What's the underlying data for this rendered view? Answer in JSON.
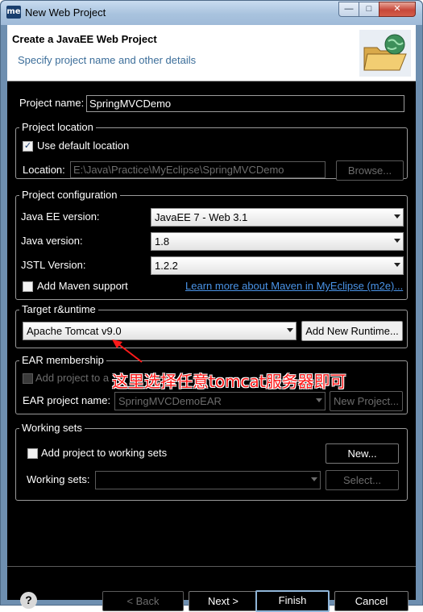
{
  "window": {
    "title": "New Web Project",
    "app_icon": "me",
    "minimize_glyph": "—",
    "maximize_glyph": "□",
    "close_glyph": "✕"
  },
  "header": {
    "title": "Create a JavaEE Web Project",
    "subtitle": "Specify project name and other details",
    "graphic_icon": "folder-globe-icon"
  },
  "project_name": {
    "label": "Project name:",
    "value": "SpringMVCDemo"
  },
  "project_location": {
    "legend": "Project location",
    "use_default_label": "Use default location",
    "use_default_checked": true,
    "location_label": "Location:",
    "location_value": "E:\\Java\\Practice\\MyEclipse\\SpringMVCDemo",
    "browse_label": "Browse..."
  },
  "project_configuration": {
    "legend": "Project configuration",
    "javaee_label": "Java EE version:",
    "javaee_value": "JavaEE 7 - Web 3.1",
    "java_label": "Java version:",
    "java_value": "1.8",
    "jstl_label": "JSTL Version:",
    "jstl_value": "1.2.2",
    "maven_label": "Add Maven support",
    "maven_checked": false,
    "maven_link": "Learn more about Maven in MyEclipse (m2e)..."
  },
  "target_runtime": {
    "legend": "Target r&untime",
    "runtime_value": "Apache Tomcat v9.0",
    "add_runtime_label": "Add New Runtime..."
  },
  "ear_membership": {
    "legend": "EAR membership",
    "add_to_ear_label": "Add project to a",
    "ear_name_label": "EAR project name:",
    "ear_name_value": "SpringMVCDemoEAR",
    "new_project_label": "New Project..."
  },
  "working_sets": {
    "legend": "Working sets",
    "add_label": "Add project to working sets",
    "new_label": "New...",
    "sets_label": "Working sets:",
    "sets_value": "",
    "select_label": "Select..."
  },
  "annotation": {
    "text": "这里选择任意tomcat服务器即可",
    "color": "#ff1a1a"
  },
  "footer": {
    "help_glyph": "?",
    "back_label": "< Back",
    "next_label": "Next >",
    "finish_label": "Finish",
    "cancel_label": "Cancel"
  }
}
